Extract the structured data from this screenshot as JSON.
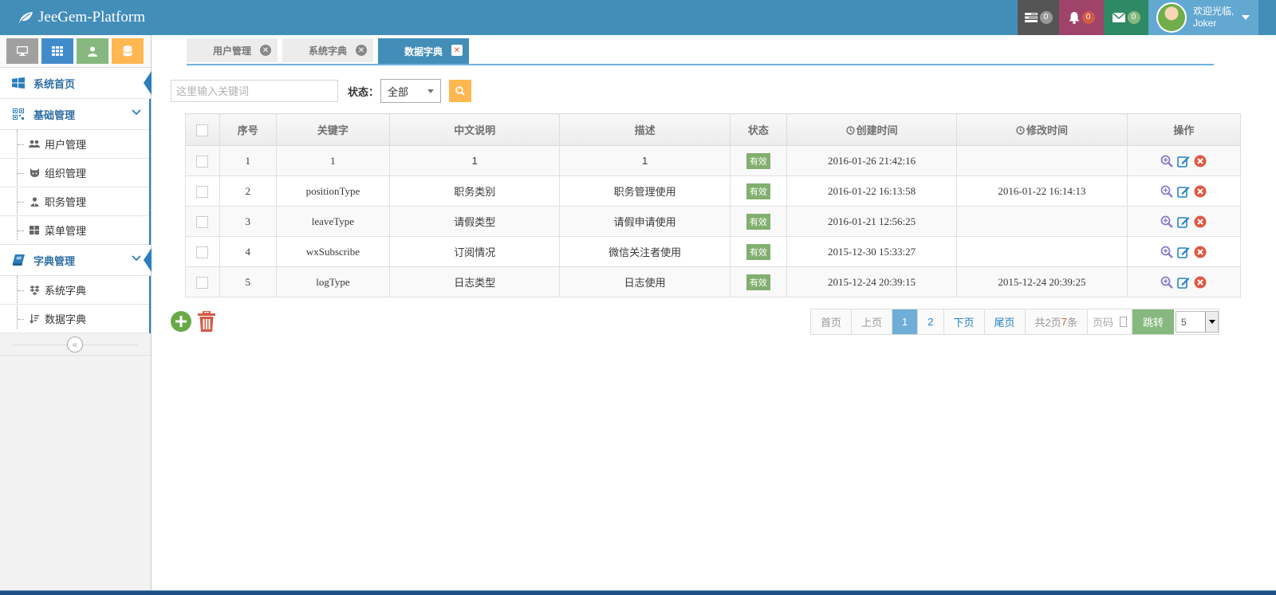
{
  "app": {
    "brand": "JeeGem-Platform",
    "accent": "#438eb9"
  },
  "topnav": {
    "tasks_count": "0",
    "notifications_count": "0",
    "messages_count": "0",
    "welcome": "欢迎光临,",
    "username": "Joker"
  },
  "sidebar": {
    "shortcuts": [
      "desktop-icon",
      "grid-icon",
      "user-icon",
      "database-icon"
    ],
    "home": "系统首页",
    "group1": {
      "label": "基础管理",
      "items": [
        "用户管理",
        "组织管理",
        "职务管理",
        "菜单管理"
      ]
    },
    "group2": {
      "label": "字典管理",
      "items": [
        "系统字典",
        "数据字典"
      ]
    },
    "collapse_glyph": "«"
  },
  "tabs": [
    "用户管理",
    "系统字典",
    "数据字典"
  ],
  "search": {
    "placeholder": "这里输入关键词",
    "status_label": "状态：",
    "status_value": "全部"
  },
  "table": {
    "headers": [
      "序号",
      "关键字",
      "中文说明",
      "描述",
      "状态",
      "创建时间",
      "修改时间",
      "操作"
    ],
    "rows": [
      {
        "no": "1",
        "key": "1",
        "name": "1",
        "desc": "1",
        "status": "有效",
        "created": "2016-01-26 21:42:16",
        "modified": ""
      },
      {
        "no": "2",
        "key": "positionType",
        "name": "职务类别",
        "desc": "职务管理使用",
        "status": "有效",
        "created": "2016-01-22 16:13:58",
        "modified": "2016-01-22 16:14:13"
      },
      {
        "no": "3",
        "key": "leaveType",
        "name": "请假类型",
        "desc": "请假申请使用",
        "status": "有效",
        "created": "2016-01-21 12:56:25",
        "modified": ""
      },
      {
        "no": "4",
        "key": "wxSubscribe",
        "name": "订阅情况",
        "desc": "微信关注者使用",
        "status": "有效",
        "created": "2015-12-30 15:33:27",
        "modified": ""
      },
      {
        "no": "5",
        "key": "logType",
        "name": "日志类型",
        "desc": "日志使用",
        "status": "有效",
        "created": "2015-12-24 20:39:15",
        "modified": "2015-12-24 20:39:25"
      }
    ]
  },
  "pager": {
    "first": "首页",
    "prev": "上页",
    "page1": "1",
    "page2": "2",
    "next": "下页",
    "last": "尾页",
    "total_prefix": "共2页",
    "total_count": "7",
    "total_suffix": "条",
    "page_input_placeholder": "页码",
    "go": "跳转",
    "page_size": "5"
  }
}
